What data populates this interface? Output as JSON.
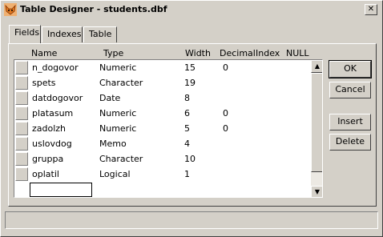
{
  "window": {
    "title": "Table Designer - students.dbf",
    "close_glyph": "✕"
  },
  "tabs": [
    {
      "label": "Fields",
      "active": true
    },
    {
      "label": "Indexes",
      "active": false
    },
    {
      "label": "Table",
      "active": false
    }
  ],
  "columns": {
    "name": "Name",
    "type": "Type",
    "width": "Width",
    "decimal": "Decimal",
    "index": "Index",
    "null": "NULL"
  },
  "fields": [
    {
      "name": "n_dogovor",
      "type": "Numeric",
      "width": "15",
      "decimal": "0"
    },
    {
      "name": "spets",
      "type": "Character",
      "width": "19",
      "decimal": ""
    },
    {
      "name": "datdogovor",
      "type": "Date",
      "width": "8",
      "decimal": ""
    },
    {
      "name": "platasum",
      "type": "Numeric",
      "width": "6",
      "decimal": "0"
    },
    {
      "name": "zadolzh",
      "type": "Numeric",
      "width": "5",
      "decimal": "0"
    },
    {
      "name": "uslovdog",
      "type": "Memo",
      "width": "4",
      "decimal": ""
    },
    {
      "name": "gruppa",
      "type": "Character",
      "width": "10",
      "decimal": ""
    },
    {
      "name": "oplatil",
      "type": "Logical",
      "width": "1",
      "decimal": ""
    }
  ],
  "new_field_value": "",
  "buttons": {
    "ok": "OK",
    "cancel": "Cancel",
    "insert": "Insert",
    "delete": "Delete"
  },
  "scrollbar": {
    "up_glyph": "▲",
    "down_glyph": "▼"
  },
  "colors": {
    "face": "#d4d0c8",
    "icon_orange": "#e07820"
  }
}
